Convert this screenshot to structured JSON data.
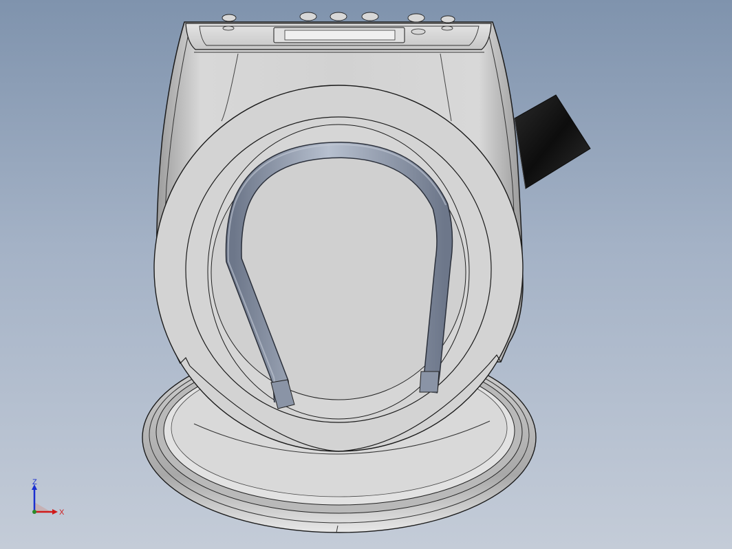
{
  "viewport": {
    "background_top": "#7f93ad",
    "background_bottom": "#c4ccd8"
  },
  "model": {
    "body_color": "#cfcfcf",
    "edge_color": "#1a1a1a",
    "tube_color": "#9aa5b8",
    "cable_color": "#151515"
  },
  "triad": {
    "z_label": "Z",
    "x_label": "X",
    "z_color": "#1a2fd0",
    "x_color": "#d01a1a"
  }
}
